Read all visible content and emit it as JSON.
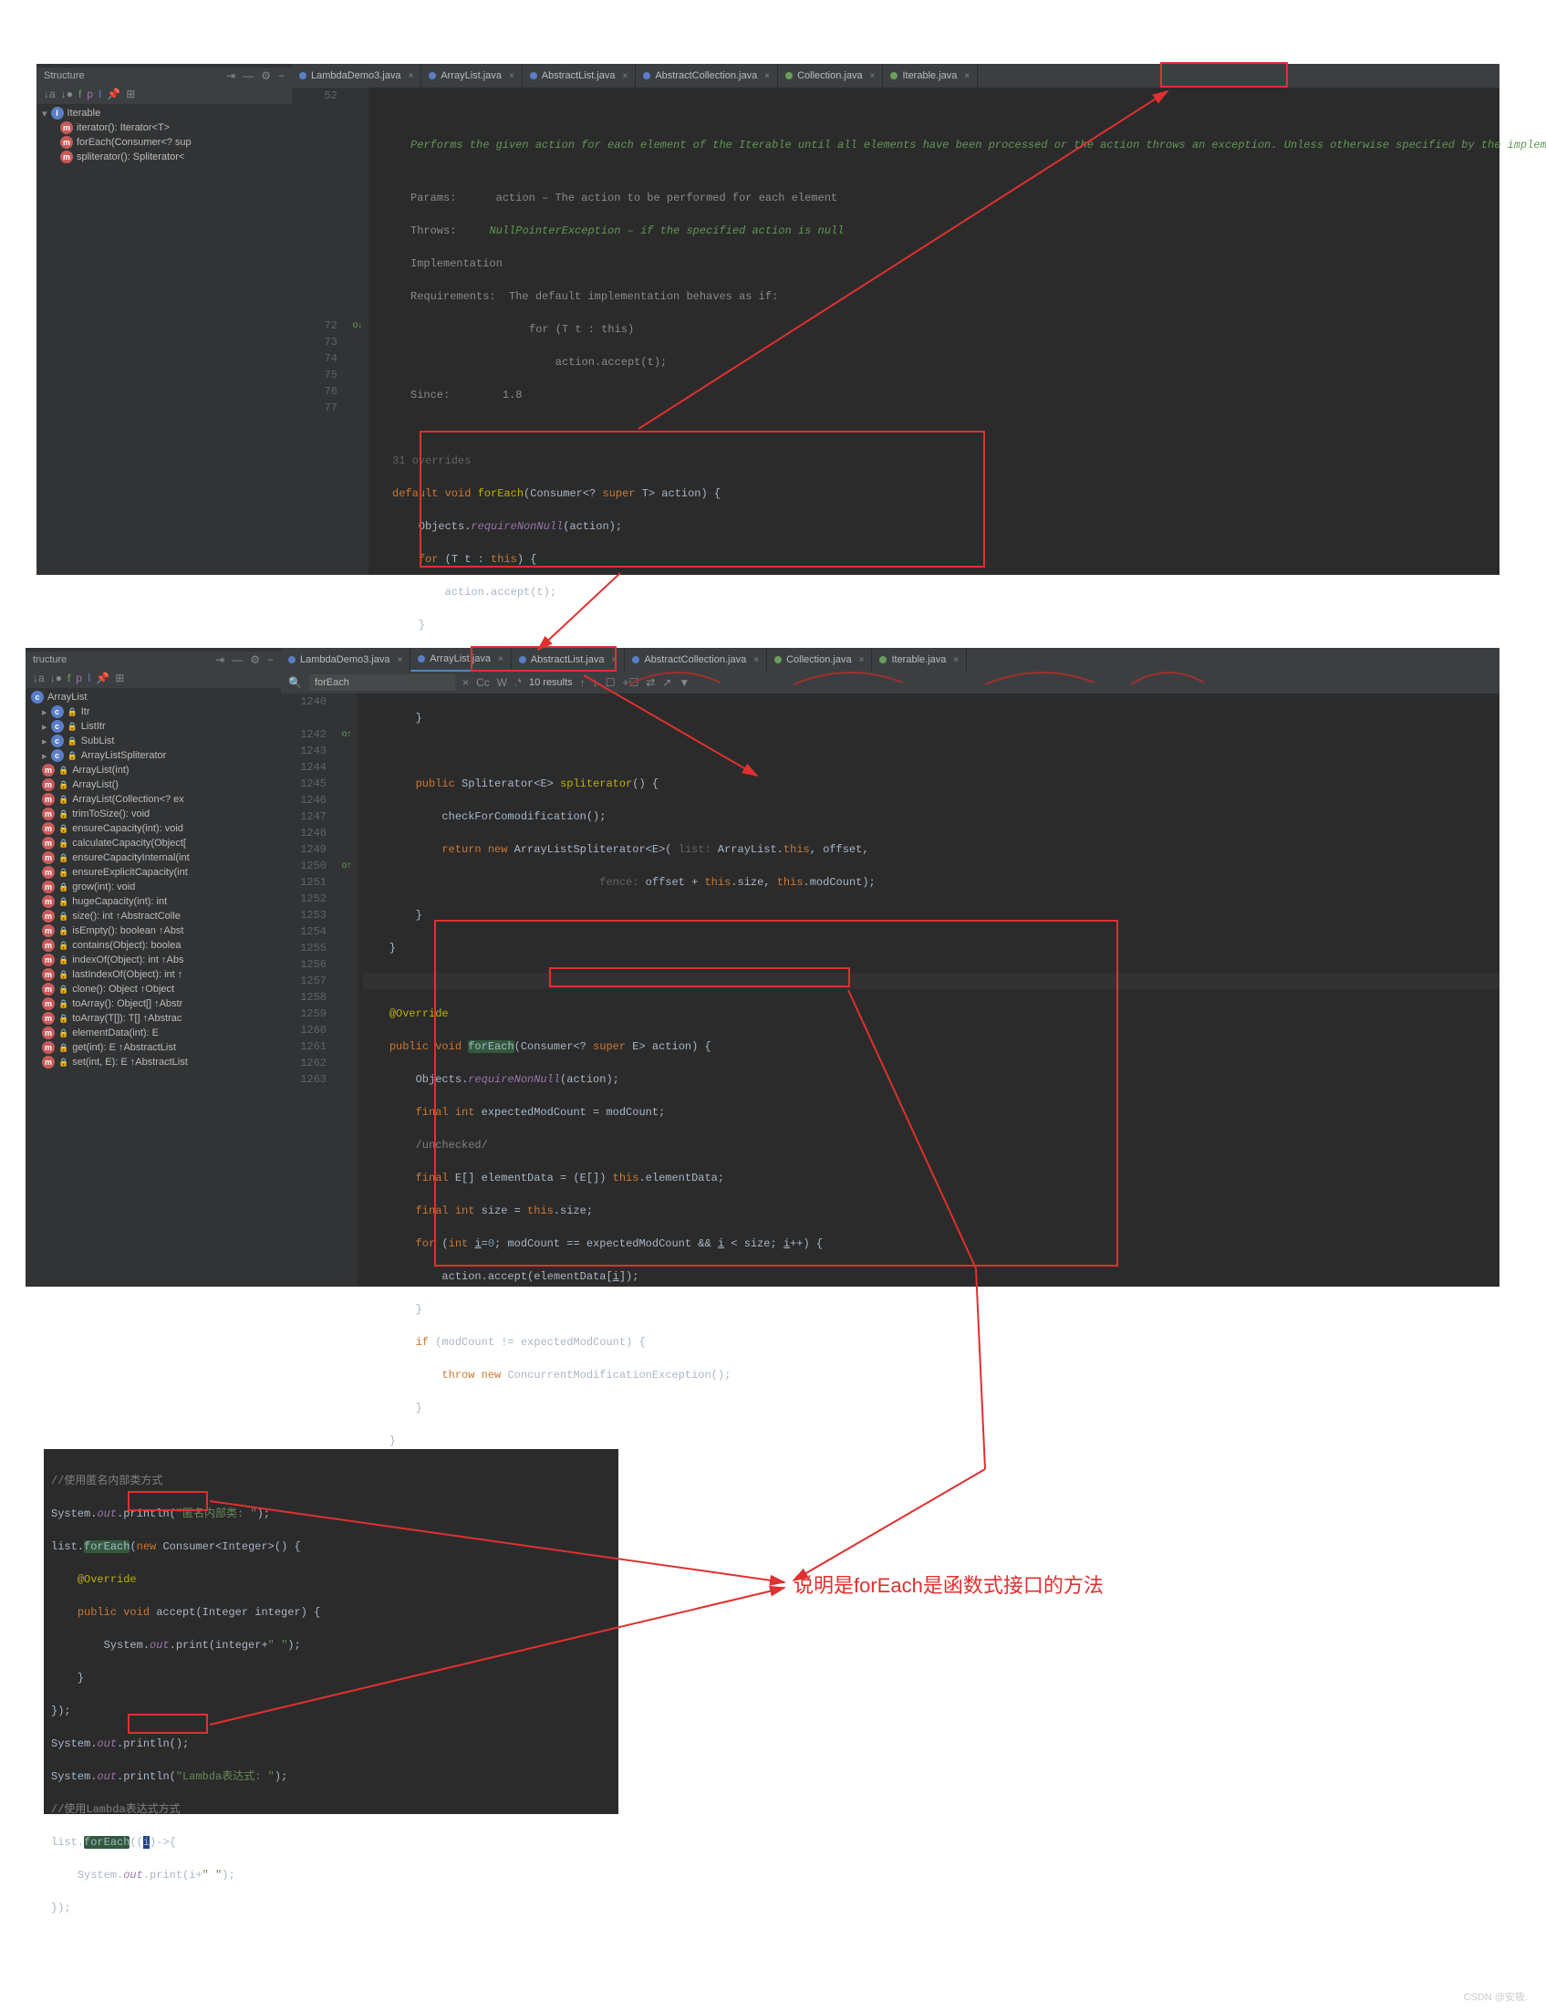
{
  "panel1": {
    "structure_title": "Structure",
    "tabs": [
      "LambdaDemo3.java",
      "ArrayList.java",
      "AbstractList.java",
      "AbstractCollection.java",
      "Collection.java",
      "Iterable.java"
    ],
    "tree": {
      "root": "Iterable",
      "items": [
        "iterator(): Iterator<T>",
        "forEach(Consumer<? sup",
        "spliterator(): Spliterator<"
      ]
    },
    "javadoc": {
      "desc": "Performs the given action for each element of the Iterable until all elements have been processed or the action throws an exception. Unless otherwise specified by the implementing class, actions are performed in the order of iteration (if an iteration order is specified). Exceptions thrown by the action are relayed to the caller.",
      "params_label": "Params:",
      "params_val": "action – The action to be performed for each element",
      "throws_label": "Throws:",
      "throws_val": "NullPointerException – if the specified action is null",
      "impl_label1": "Implementation",
      "impl_label2": "Requirements:",
      "impl_val": "The default implementation behaves as if:",
      "impl_code1": "for (T t : this)",
      "impl_code2": "    action.accept(t);",
      "since_label": "Since:",
      "since_val": "1.8"
    },
    "overrides_label": "31 overrides",
    "gutter_start": 52,
    "gutter_lines": [
      "52",
      "",
      "",
      "",
      "",
      "",
      "",
      "",
      "",
      "",
      "",
      "",
      "",
      "",
      "72",
      "73",
      "74",
      "75",
      "76",
      "77"
    ],
    "code_lines": {
      "l72": "default void forEach(Consumer<? super T> action) {",
      "l73": "    Objects.requireNonNull(action);",
      "l74": "    for (T t : this) {",
      "l75": "        action.accept(t);",
      "l76": "    }",
      "l77": "}"
    }
  },
  "panel2": {
    "structure_title": "tructure",
    "tabs": [
      "LambdaDemo3.java",
      "ArrayList.java",
      "AbstractList.java",
      "AbstractCollection.java",
      "Collection.java",
      "Iterable.java"
    ],
    "search": {
      "placeholder": "",
      "value": "forEach",
      "results": "10 results",
      "cc": "Cc",
      "w": "W",
      "re": ".*"
    },
    "tree": {
      "root": "ArrayList",
      "items": [
        {
          "t": "c",
          "l": "Itr"
        },
        {
          "t": "c",
          "l": "ListItr"
        },
        {
          "t": "c",
          "l": "SubList"
        },
        {
          "t": "c",
          "l": "ArrayListSpliterator"
        },
        {
          "t": "m",
          "l": "ArrayList(int)"
        },
        {
          "t": "m",
          "l": "ArrayList()"
        },
        {
          "t": "m",
          "l": "ArrayList(Collection<? ex"
        },
        {
          "t": "m",
          "l": "trimToSize(): void"
        },
        {
          "t": "m",
          "l": "ensureCapacity(int): void"
        },
        {
          "t": "m",
          "l": "calculateCapacity(Object["
        },
        {
          "t": "m",
          "l": "ensureCapacityInternal(int"
        },
        {
          "t": "m",
          "l": "ensureExplicitCapacity(int"
        },
        {
          "t": "m",
          "l": "grow(int): void"
        },
        {
          "t": "m",
          "l": "hugeCapacity(int): int"
        },
        {
          "t": "m",
          "l": "size(): int ↑AbstractColle"
        },
        {
          "t": "m",
          "l": "isEmpty(): boolean ↑Abst"
        },
        {
          "t": "m",
          "l": "contains(Object): boolea"
        },
        {
          "t": "m",
          "l": "indexOf(Object): int ↑Abs"
        },
        {
          "t": "m",
          "l": "lastIndexOf(Object): int ↑"
        },
        {
          "t": "m",
          "l": "clone(): Object ↑Object"
        },
        {
          "t": "m",
          "l": "toArray(): Object[] ↑Abstr"
        },
        {
          "t": "m",
          "l": "toArray(T[]): T[] ↑Abstrac"
        },
        {
          "t": "m",
          "l": "elementData(int): E"
        },
        {
          "t": "m",
          "l": "get(int): E ↑AbstractList"
        },
        {
          "t": "m",
          "l": "set(int, E): E ↑AbstractList"
        }
      ]
    },
    "gutter_lines": [
      "1240",
      "",
      "1242",
      "1243",
      "1244",
      "1245",
      "1246",
      "1247",
      "1248",
      "1249",
      "1250",
      "1251",
      "1252",
      "1253",
      "1254",
      "1255",
      "1256",
      "1257",
      "1258",
      "1259",
      "1260",
      "1261",
      "1262",
      "1263"
    ],
    "code": {
      "l1240": "        }",
      "l1242": "        public Spliterator<E> spliterator() {",
      "l1243": "            checkForComodification();",
      "l1244": "            return new ArrayListSpliterator<E>( list: ArrayList.this, offset,",
      "l1245": "                                    fence: offset + this.size, this.modCount);",
      "l1246": "        }",
      "l1247": "    }",
      "l1249": "    @Override",
      "l1250": "    public void forEach(Consumer<? super E> action) {",
      "l1251": "        Objects.requireNonNull(action);",
      "l1252": "        final int expectedModCount = modCount;",
      "l1253": "        /unchecked/",
      "l1254": "        final E[] elementData = (E[]) this.elementData;",
      "l1255": "        final int size = this.size;",
      "l1256": "        for (int i=0; modCount == expectedModCount && i < size; i++) {",
      "l1257": "            action.accept(elementData[i]);",
      "l1258": "        }",
      "l1259": "        if (modCount != expectedModCount) {",
      "l1260": "            throw new ConcurrentModificationException();",
      "l1261": "        }",
      "l1262": "    }"
    }
  },
  "panel3": {
    "lines_raw": [
      "//使用匿名内部类方式",
      "System.out.println(\"匿名内部类: \");",
      "list.forEach(new Consumer<Integer>() {",
      "    @Override",
      "    public void accept(Integer integer) {",
      "        System.out.print(integer+\" \");",
      "    }",
      "});",
      "System.out.println();",
      "System.out.println(\"Lambda表达式: \");",
      "//使用Lambda表达式方式",
      "list.forEach((i)->{",
      "    System.out.print(i+\" \");",
      "});"
    ]
  },
  "annotation": "说明是forEach是函数式接口的方法",
  "watermark": "CSDN @安筱."
}
